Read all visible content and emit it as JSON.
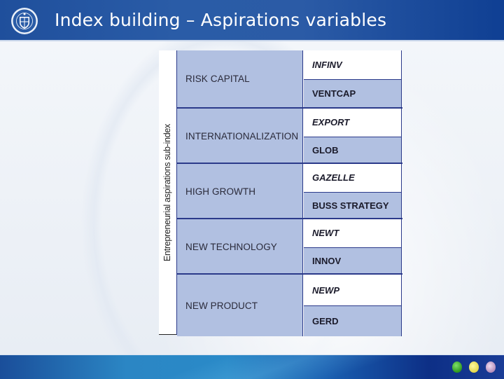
{
  "header": {
    "title": "Index building – Aspirations variables",
    "logo": "university-seal-icon"
  },
  "table": {
    "side_label": "Entrepreneurial aspirations sub-index",
    "categories": [
      {
        "name": "RISK CAPITAL",
        "variables": [
          "INFINV",
          "VENTCAP"
        ]
      },
      {
        "name": "INTERNATIONALIZATION",
        "variables": [
          "EXPORT",
          "GLOB"
        ]
      },
      {
        "name": "HIGH GROWTH",
        "variables": [
          "GAZELLE",
          "BUSS STRATEGY"
        ]
      },
      {
        "name": "NEW TECHNOLOGY",
        "variables": [
          "NEWT",
          "INNOV"
        ]
      },
      {
        "name": "NEW PRODUCT",
        "variables": [
          "NEWP",
          "GERD"
        ]
      }
    ]
  },
  "footer": {
    "icons": [
      "green-bud-icon",
      "yellow-bud-icon",
      "purple-bud-icon"
    ]
  }
}
